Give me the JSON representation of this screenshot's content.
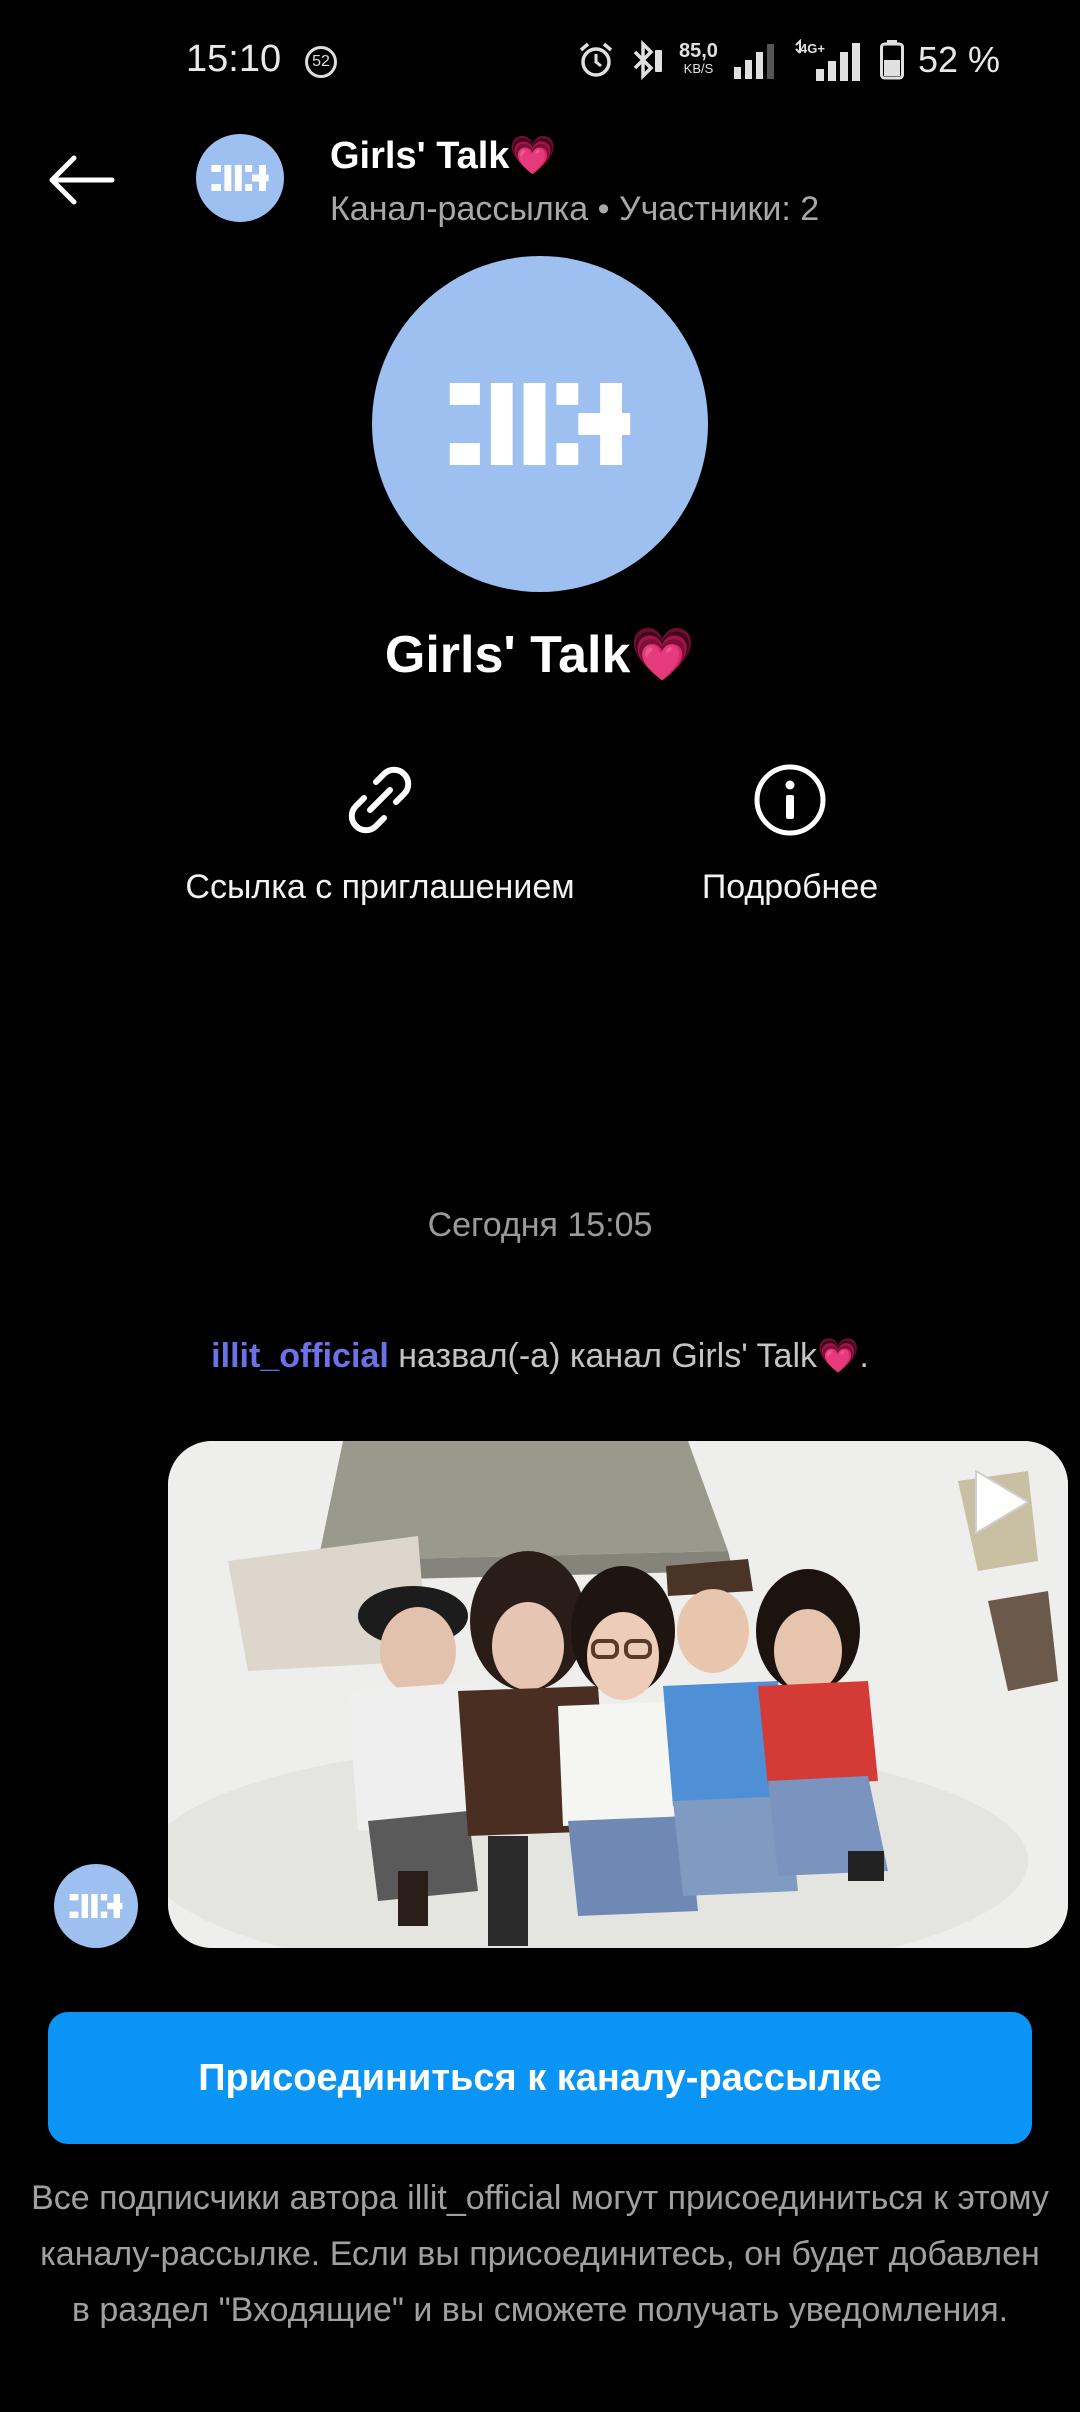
{
  "status_bar": {
    "time": "15:10",
    "notification_badge": "52",
    "net_speed_value": "85,0",
    "net_speed_unit": "KB/S",
    "network_label": "4G+",
    "battery_percent": "52 %"
  },
  "header": {
    "title": "Girls' Talk💗",
    "subtitle": "Канал-рассылка • Участники: 2"
  },
  "channel": {
    "name": "Girls' Talk💗",
    "avatar_color": "#9ec0f0"
  },
  "actions": {
    "invite_label": "Ссылка с приглашением",
    "info_label": "Подробнее"
  },
  "chat": {
    "date_stamp": "Сегодня 15:05",
    "system_user": "illit_official",
    "system_text": " назвал(-а) канал Girls' Talk💗."
  },
  "join_button": "Присоединиться к каналу-рассылке",
  "footnote": "Все подписчики автора illit_official могут присоединиться к этому каналу-рассылке. Если вы присоединитесь, он будет добавлен в раздел \"Входящие\" и вы сможете получать уведомления.",
  "colors": {
    "accent": "#0a95f6",
    "username": "#6b72e8",
    "background": "#000000"
  }
}
